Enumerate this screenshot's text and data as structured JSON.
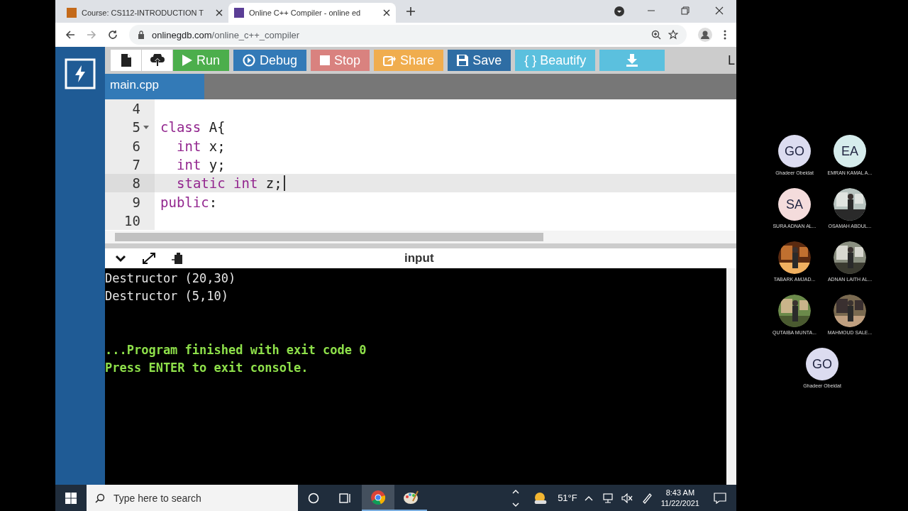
{
  "browser": {
    "tabs": [
      {
        "title": "Course: CS112-INTRODUCTION T",
        "selected": false
      },
      {
        "title": "Online C++ Compiler - online ed",
        "selected": true
      }
    ],
    "url_host": "onlinegdb.com",
    "url_path": "/online_c++_compiler"
  },
  "toolbar": {
    "buttons": [
      {
        "kind": "file"
      },
      {
        "kind": "upload"
      },
      {
        "kind": "run",
        "label": "Run",
        "color": "#4cae4c"
      },
      {
        "kind": "debug",
        "label": "Debug",
        "color": "#337ab7"
      },
      {
        "kind": "stop",
        "label": "Stop",
        "color": "#d9827f"
      },
      {
        "kind": "share",
        "label": "Share",
        "color": "#f0ad4e"
      },
      {
        "kind": "save",
        "label": "Save",
        "color": "#2e6da4"
      },
      {
        "kind": "beautify",
        "label": "{ } Beautify",
        "color": "#5bc0de"
      },
      {
        "kind": "download",
        "color": "#5bc0de"
      }
    ],
    "cut_text": "L"
  },
  "file_tabs": [
    {
      "name": "main.cpp",
      "selected": true
    }
  ],
  "editor": {
    "lines": [
      {
        "number": "4",
        "active": false,
        "fold": false
      },
      {
        "number": "5",
        "tokens": [
          {
            "kind": "kw",
            "text": "class"
          },
          {
            "kind": "plain",
            "text": " A{"
          }
        ],
        "indented": false,
        "active": false,
        "fold": true
      },
      {
        "number": "6",
        "tokens": [
          {
            "kind": "kw",
            "text": "int"
          },
          {
            "kind": "plain",
            "text": " x;"
          }
        ],
        "indented": true,
        "active": false,
        "fold": false
      },
      {
        "number": "7",
        "tokens": [
          {
            "kind": "kw",
            "text": "int"
          },
          {
            "kind": "plain",
            "text": " y;"
          }
        ],
        "indented": true,
        "active": false,
        "fold": false
      },
      {
        "number": "8",
        "tokens": [
          {
            "kind": "kw",
            "text": "static int"
          },
          {
            "kind": "plain",
            "text": " z;"
          }
        ],
        "indented": true,
        "active": true,
        "fold": false
      },
      {
        "number": "9",
        "tokens": [
          {
            "kind": "kw",
            "text": "public"
          },
          {
            "kind": "plain",
            "text": ":"
          }
        ],
        "indented": false,
        "active": false,
        "fold": false
      },
      {
        "number": "10",
        "active": false,
        "fold": false
      }
    ]
  },
  "output": {
    "title": "input",
    "lines": [
      {
        "kind": "normal",
        "text": "Destructor (20,30)"
      },
      {
        "kind": "normal",
        "text": "Destructor (5,10)"
      },
      {
        "kind": "blank"
      },
      {
        "kind": "blank"
      },
      {
        "kind": "status",
        "text": "...Program finished with exit code 0"
      },
      {
        "kind": "status",
        "text": "Press ENTER to exit console."
      }
    ]
  },
  "taskbar": {
    "search_placeholder": "Type here to search",
    "apps": [
      {
        "kind": "chrome",
        "selected": true
      },
      {
        "kind": "paint",
        "selected": false
      }
    ],
    "weather": "51°F",
    "time": "8:43 AM",
    "date": "11/22/2021"
  },
  "participants": [
    {
      "kind": "initials",
      "initials": "GO",
      "name": "Ghadeer Obeidat",
      "color": "#dcdcf0"
    },
    {
      "kind": "initials",
      "initials": "EA",
      "name": "EMRAN KAMAL A...",
      "color": "#d6ecec"
    },
    {
      "kind": "initials",
      "initials": "SA",
      "name": "SURA ADNAN AL...",
      "color": "#f4dcdc"
    },
    {
      "kind": "picture",
      "name": "OSAMAH ABDUL..."
    },
    {
      "kind": "picture",
      "name": "TABARK AMJAD..."
    },
    {
      "kind": "picture",
      "name": "ADNAN LAITH AL..."
    },
    {
      "kind": "picture",
      "name": "QUTAIBA MUNTA..."
    },
    {
      "kind": "picture",
      "name": "MAHMOUD SALE..."
    },
    {
      "kind": "initials",
      "initials": "GO",
      "name": "Ghadeer Obeidat",
      "color": "#dcdcf0"
    }
  ]
}
